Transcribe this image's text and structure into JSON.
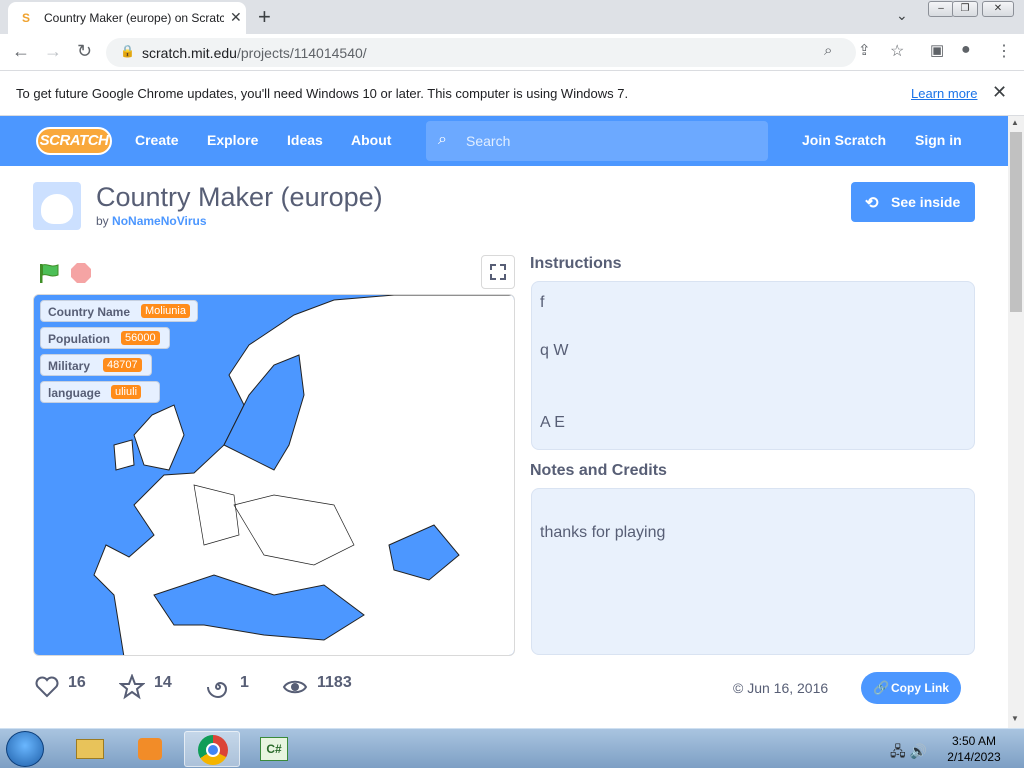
{
  "browser": {
    "tab_title": "Country Maker (europe) on Scratch",
    "url_host": "scratch.mit.edu",
    "url_path": "/projects/114014540/",
    "infobar_text": "To get future Google Chrome updates, you'll need Windows 10 or later. This computer is using Windows 7.",
    "learn_more": "Learn more"
  },
  "nav": {
    "logo": "SCRATCH",
    "create": "Create",
    "explore": "Explore",
    "ideas": "Ideas",
    "about": "About",
    "search_placeholder": "Search",
    "join": "Join Scratch",
    "signin": "Sign in"
  },
  "project": {
    "title": "Country Maker (europe)",
    "by": "by",
    "author": "NoNameNoVirus",
    "see_inside": "See inside",
    "monitors": [
      {
        "label": "Country Name",
        "value": "Moliunia"
      },
      {
        "label": "Population",
        "value": "56000"
      },
      {
        "label": "Military",
        "value": "48707"
      },
      {
        "label": "language",
        "value": "uliuli"
      }
    ],
    "instructions_title": "Instructions",
    "instructions_lines": [
      "f",
      "q W",
      "A E"
    ],
    "notes_title": "Notes and Credits",
    "notes_text": "thanks for playing",
    "stats": {
      "loves": "16",
      "favorites": "14",
      "remixes": "1",
      "views": "1183"
    },
    "date": "© Jun 16, 2016",
    "copy_link": "Copy Link"
  },
  "taskbar": {
    "time": "3:50 AM",
    "date": "2/14/2023"
  },
  "colors": {
    "scratch_blue": "#4c97ff",
    "monitor_orange": "#ff8c1a",
    "notes_bg": "#e9f1fc",
    "text": "#575e75"
  }
}
